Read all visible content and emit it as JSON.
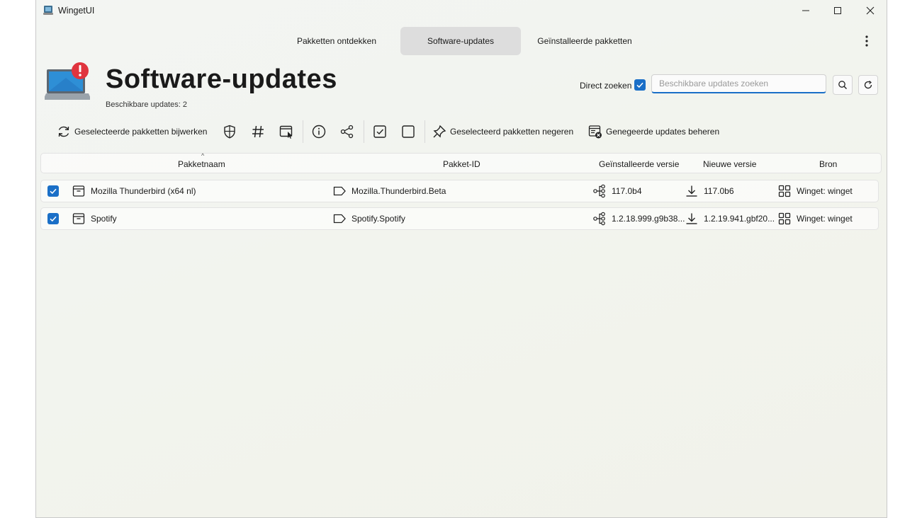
{
  "window": {
    "title": "WingetUI",
    "controls": [
      "minimize",
      "maximize",
      "close"
    ]
  },
  "tabs": [
    {
      "label": "Pakketten ontdekken",
      "active": false
    },
    {
      "label": "Software-updates",
      "active": true
    },
    {
      "label": "Geïnstalleerde pakketten",
      "active": false
    }
  ],
  "header": {
    "title": "Software-updates",
    "subtitle": "Beschikbare updates: 2",
    "icon": "laptop-alert-icon"
  },
  "search": {
    "direct_label": "Direct zoeken",
    "direct_checked": true,
    "placeholder": "Beschikbare updates zoeken",
    "value": ""
  },
  "toolbar": {
    "update_selected": "Geselecteerde pakketten bijwerken",
    "ignore_selected": "Geselecteerd pakketten negeren",
    "manage_ignored": "Genegeerde updates beheren",
    "icons": [
      "refresh-icon",
      "shield-icon",
      "hash-icon",
      "window-cursor-icon",
      "info-icon",
      "share-icon",
      "check-all-icon",
      "uncheck-all-icon",
      "pin-off-icon",
      "ignored-list-icon"
    ]
  },
  "columns": {
    "name": "Pakketnaam",
    "id": "Pakket-ID",
    "installed": "Geïnstalleerde versie",
    "new": "Nieuwe versie",
    "source": "Bron"
  },
  "rows": [
    {
      "checked": true,
      "name": "Mozilla Thunderbird (x64 nl)",
      "id": "Mozilla.Thunderbird.Beta",
      "installed": "117.0b4",
      "new": "117.0b6",
      "source": "Winget: winget"
    },
    {
      "checked": true,
      "name": "Spotify",
      "id": "Spotify.Spotify",
      "installed": "1.2.18.999.g9b38...",
      "new": "1.2.19.941.gbf20...",
      "source": "Winget: winget"
    }
  ],
  "colors": {
    "accent": "#1a6fc7",
    "alert": "#e0343e",
    "active_tab": "#dddddd"
  }
}
